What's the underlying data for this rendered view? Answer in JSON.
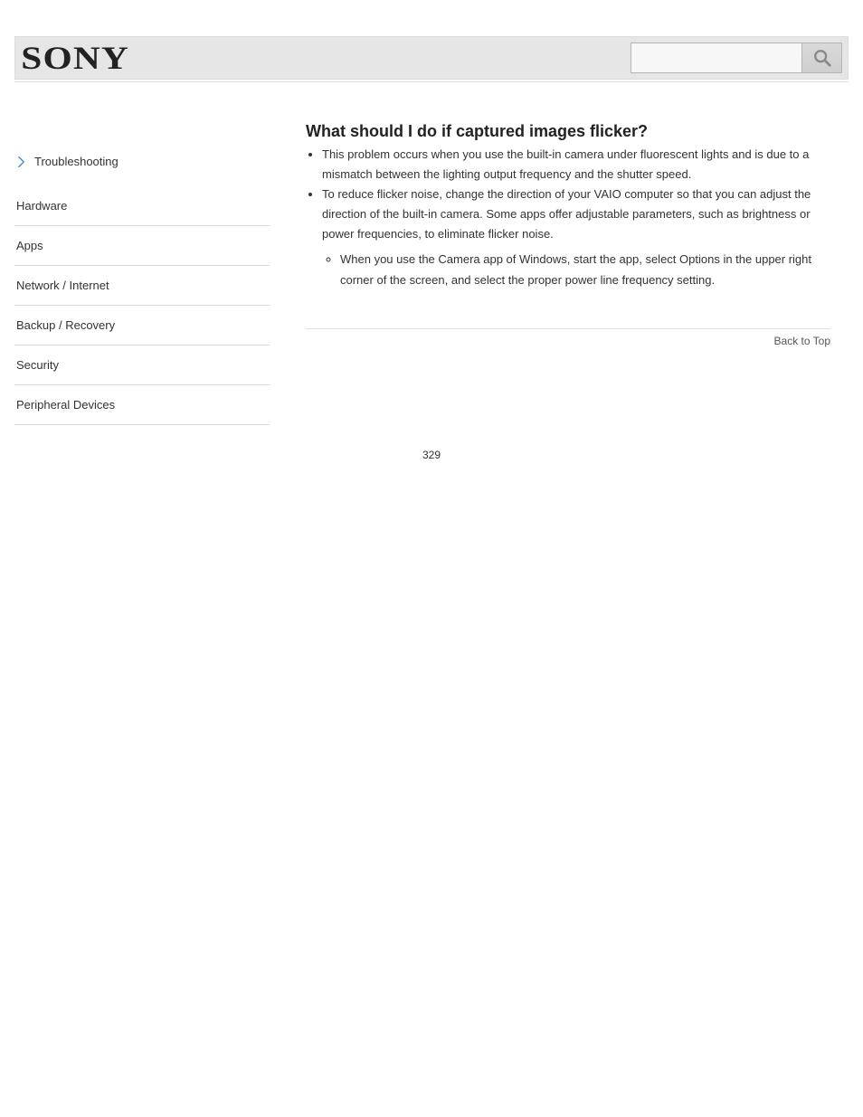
{
  "header": {
    "logo_text": "SONY",
    "search_placeholder": ""
  },
  "sidebar": {
    "chevron_label": "Troubleshooting",
    "items": [
      {
        "label": "Hardware"
      },
      {
        "label": "Apps"
      },
      {
        "label": "Network / Internet"
      },
      {
        "label": "Backup / Recovery"
      },
      {
        "label": "Security"
      },
      {
        "label": "Peripheral Devices"
      }
    ]
  },
  "main": {
    "title": "What should I do if captured images flicker?",
    "bullets": [
      "This problem occurs when you use the built-in camera under fluorescent lights and is due to a mismatch between the lighting output frequency and the shutter speed.",
      "To reduce flicker noise, change the direction of your VAIO computer so that you can adjust the direction of the built-in camera. Some apps offer adjustable parameters, such as brightness or power frequencies, to eliminate flicker noise."
    ],
    "sub_bullets": [
      "When you use the Camera app of Windows, start the app, select Options in the upper right corner of the screen, and select the proper power line frequency setting."
    ],
    "back_to_top": "Back to Top"
  },
  "page_number": "329"
}
